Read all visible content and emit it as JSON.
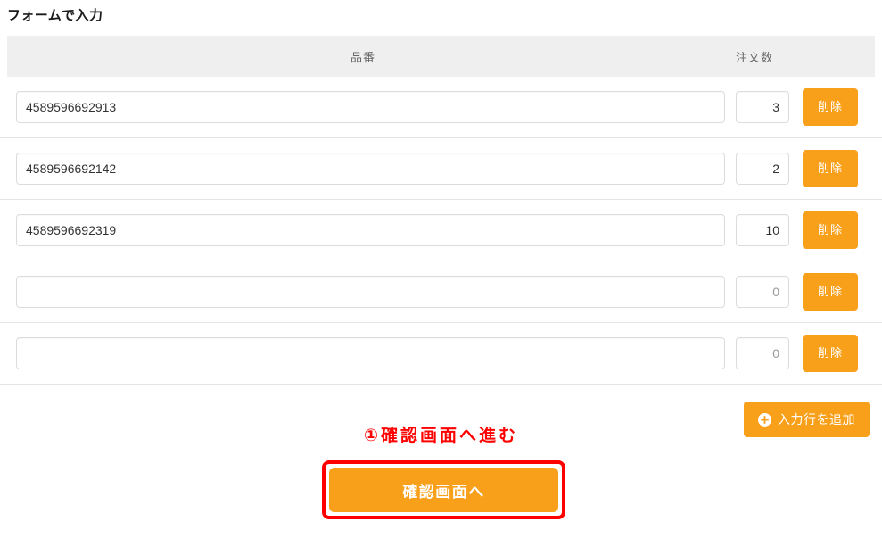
{
  "page": {
    "title": "フォームで入力"
  },
  "table": {
    "headers": {
      "part_number": "品番",
      "quantity": "注文数"
    },
    "rows": [
      {
        "part_number": "4589596692913",
        "quantity": "3",
        "delete_label": "削除"
      },
      {
        "part_number": "4589596692142",
        "quantity": "2",
        "delete_label": "削除"
      },
      {
        "part_number": "4589596692319",
        "quantity": "10",
        "delete_label": "削除"
      },
      {
        "part_number": "",
        "quantity": "0",
        "delete_label": "削除"
      },
      {
        "part_number": "",
        "quantity": "0",
        "delete_label": "削除"
      }
    ]
  },
  "actions": {
    "add_row_label": "入力行を追加",
    "add_row_icon": "plus-circle-icon",
    "confirm_label": "確認画面へ"
  },
  "annotation": {
    "step_label": "①確認画面へ進む"
  },
  "colors": {
    "accent_orange": "#f9a01b",
    "annotation_red": "#ff0000",
    "header_gray": "#efefef"
  }
}
